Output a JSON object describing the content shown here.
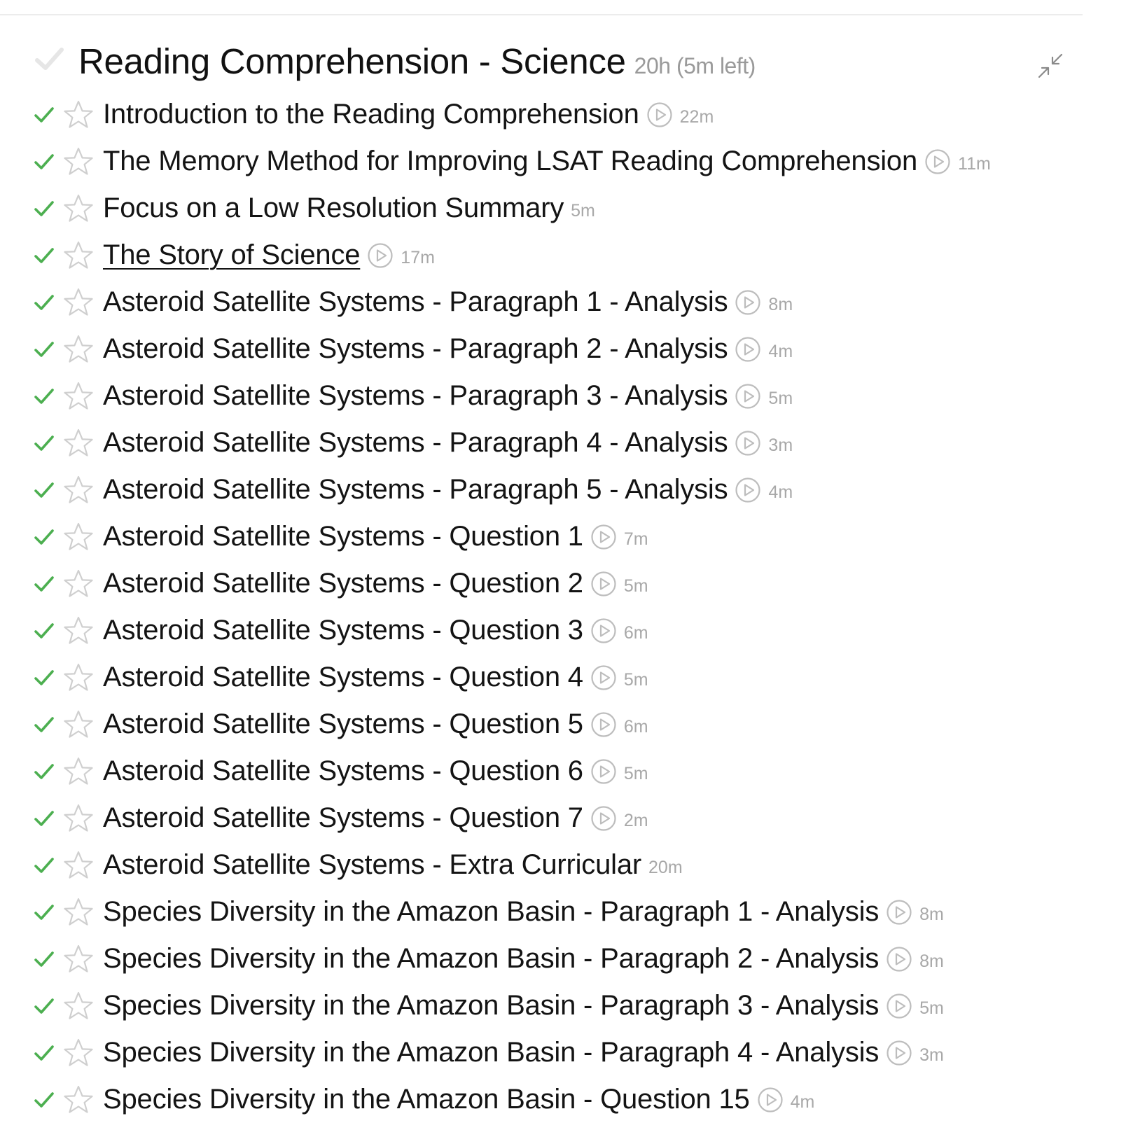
{
  "colors": {
    "check_green": "#4caf50",
    "icon_gray": "#bdbdbd",
    "meta_gray": "#9a9a9a"
  },
  "section": {
    "title": "Reading Comprehension - Science",
    "meta": "20h (5m left)",
    "collapse_icon": "collapse-arrows-icon"
  },
  "lessons": [
    {
      "title": "Introduction to the Reading Comprehension",
      "has_video": true,
      "duration": "22m",
      "completed": true,
      "underlined": false
    },
    {
      "title": "The Memory Method for Improving LSAT Reading Comprehension",
      "has_video": true,
      "duration": "11m",
      "completed": true,
      "underlined": false
    },
    {
      "title": "Focus on a Low Resolution Summary",
      "has_video": false,
      "duration": "5m",
      "completed": true,
      "underlined": false
    },
    {
      "title": "The Story of Science",
      "has_video": true,
      "duration": "17m",
      "completed": true,
      "underlined": true
    },
    {
      "title": "Asteroid Satellite Systems - Paragraph 1 - Analysis",
      "has_video": true,
      "duration": "8m",
      "completed": true,
      "underlined": false
    },
    {
      "title": "Asteroid Satellite Systems - Paragraph 2 - Analysis",
      "has_video": true,
      "duration": "4m",
      "completed": true,
      "underlined": false
    },
    {
      "title": "Asteroid Satellite Systems - Paragraph 3 - Analysis",
      "has_video": true,
      "duration": "5m",
      "completed": true,
      "underlined": false
    },
    {
      "title": "Asteroid Satellite Systems - Paragraph 4 - Analysis",
      "has_video": true,
      "duration": "3m",
      "completed": true,
      "underlined": false
    },
    {
      "title": "Asteroid Satellite Systems - Paragraph 5 - Analysis",
      "has_video": true,
      "duration": "4m",
      "completed": true,
      "underlined": false
    },
    {
      "title": "Asteroid Satellite Systems - Question 1",
      "has_video": true,
      "duration": "7m",
      "completed": true,
      "underlined": false
    },
    {
      "title": "Asteroid Satellite Systems - Question 2",
      "has_video": true,
      "duration": "5m",
      "completed": true,
      "underlined": false
    },
    {
      "title": "Asteroid Satellite Systems - Question 3",
      "has_video": true,
      "duration": "6m",
      "completed": true,
      "underlined": false
    },
    {
      "title": "Asteroid Satellite Systems - Question 4",
      "has_video": true,
      "duration": "5m",
      "completed": true,
      "underlined": false
    },
    {
      "title": "Asteroid Satellite Systems - Question 5",
      "has_video": true,
      "duration": "6m",
      "completed": true,
      "underlined": false
    },
    {
      "title": "Asteroid Satellite Systems - Question 6",
      "has_video": true,
      "duration": "5m",
      "completed": true,
      "underlined": false
    },
    {
      "title": "Asteroid Satellite Systems - Question 7",
      "has_video": true,
      "duration": "2m",
      "completed": true,
      "underlined": false
    },
    {
      "title": "Asteroid Satellite Systems - Extra Curricular",
      "has_video": false,
      "duration": "20m",
      "completed": true,
      "underlined": false
    },
    {
      "title": "Species Diversity in the Amazon Basin - Paragraph 1 - Analysis",
      "has_video": true,
      "duration": "8m",
      "completed": true,
      "underlined": false
    },
    {
      "title": "Species Diversity in the Amazon Basin - Paragraph 2 - Analysis",
      "has_video": true,
      "duration": "8m",
      "completed": true,
      "underlined": false
    },
    {
      "title": "Species Diversity in the Amazon Basin - Paragraph 3 - Analysis",
      "has_video": true,
      "duration": "5m",
      "completed": true,
      "underlined": false
    },
    {
      "title": "Species Diversity in the Amazon Basin - Paragraph 4 - Analysis",
      "has_video": true,
      "duration": "3m",
      "completed": true,
      "underlined": false
    },
    {
      "title": "Species Diversity in the Amazon Basin - Question 15",
      "has_video": true,
      "duration": "4m",
      "completed": true,
      "underlined": false
    }
  ]
}
